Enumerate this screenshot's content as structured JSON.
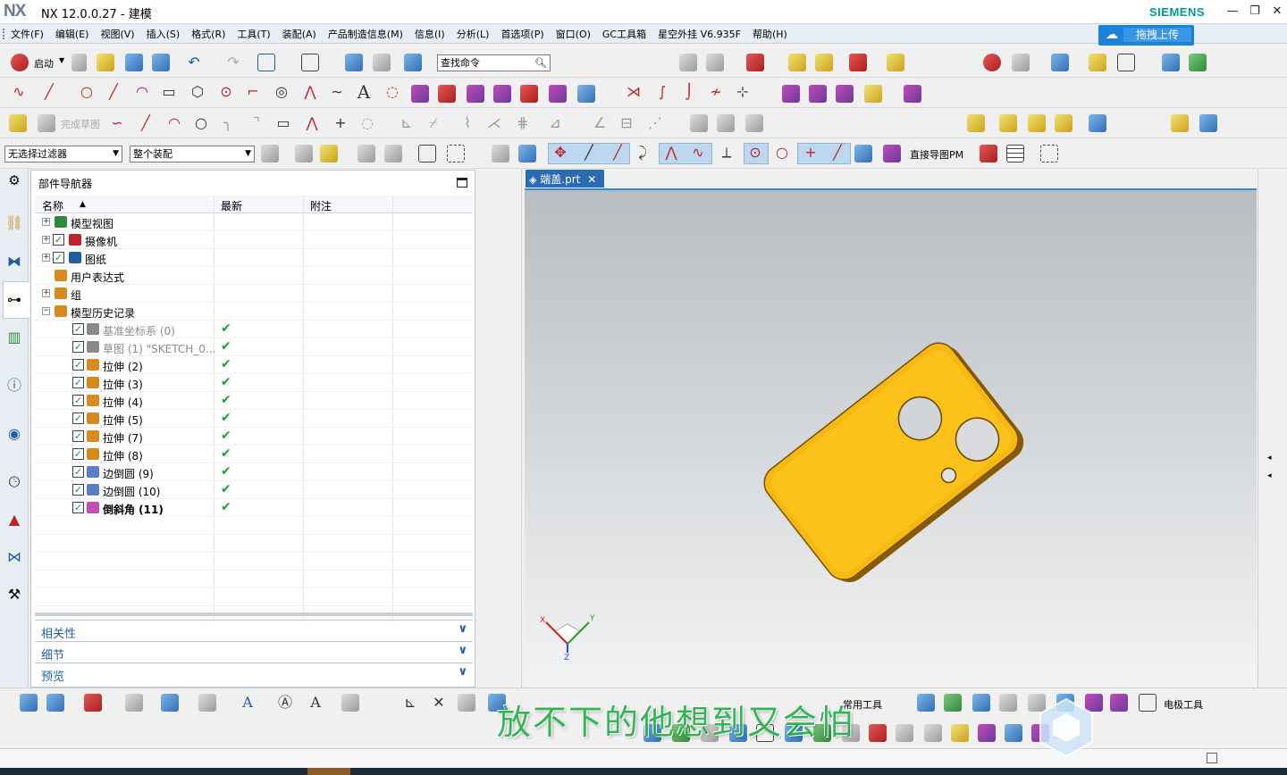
{
  "app": {
    "logo": "NX",
    "title": "NX 12.0.0.27 - 建模",
    "brand": "SIEMENS"
  },
  "window_controls": [
    "—",
    "❐",
    "✕"
  ],
  "menu": [
    "文件(F)",
    "编辑(E)",
    "视图(V)",
    "插入(S)",
    "格式(R)",
    "工具(T)",
    "装配(A)",
    "产品制造信息(M)",
    "信息(I)",
    "分析(L)",
    "首选项(P)",
    "窗口(O)",
    "GC工具箱",
    "星空外挂 V6.935F",
    "帮助(H)"
  ],
  "upload_button": "拖拽上传",
  "toolbar": {
    "start_label": "启动",
    "search_placeholder": "查找命令",
    "finish_sketch": "完成草图",
    "filter_select": "无选择过滤器",
    "assembly_select": "整个装配",
    "direct_sketch_pm": "直接导图PM"
  },
  "navigator": {
    "title": "部件导航器",
    "columns": [
      "名称",
      "最新",
      "附注"
    ],
    "rows": [
      {
        "label": "模型视图",
        "expand": "+",
        "checked": false,
        "status": "",
        "style": "normal"
      },
      {
        "label": "摄像机",
        "expand": "+",
        "checked": true,
        "status": "",
        "style": "normal"
      },
      {
        "label": "图纸",
        "expand": "+",
        "checked": true,
        "status": "",
        "style": "normal"
      },
      {
        "label": "用户表达式",
        "expand": "",
        "checked": false,
        "status": "",
        "style": "normal"
      },
      {
        "label": "组",
        "expand": "+",
        "checked": false,
        "status": "",
        "style": "normal"
      },
      {
        "label": "模型历史记录",
        "expand": "−",
        "checked": false,
        "status": "",
        "style": "normal"
      },
      {
        "label": "基准坐标系 (0)",
        "expand": "",
        "checked": true,
        "status": "✔",
        "style": "gray"
      },
      {
        "label": "草图 (1) \"SKETCH_0...",
        "expand": "",
        "checked": true,
        "status": "✔",
        "style": "gray"
      },
      {
        "label": "拉伸 (2)",
        "expand": "",
        "checked": true,
        "status": "✔",
        "style": "normal"
      },
      {
        "label": "拉伸 (3)",
        "expand": "",
        "checked": true,
        "status": "✔",
        "style": "normal"
      },
      {
        "label": "拉伸 (4)",
        "expand": "",
        "checked": true,
        "status": "✔",
        "style": "normal"
      },
      {
        "label": "拉伸 (5)",
        "expand": "",
        "checked": true,
        "status": "✔",
        "style": "normal"
      },
      {
        "label": "拉伸 (7)",
        "expand": "",
        "checked": true,
        "status": "✔",
        "style": "normal"
      },
      {
        "label": "拉伸 (8)",
        "expand": "",
        "checked": true,
        "status": "✔",
        "style": "normal"
      },
      {
        "label": "边倒圆 (9)",
        "expand": "",
        "checked": true,
        "status": "✔",
        "style": "normal"
      },
      {
        "label": "边倒圆 (10)",
        "expand": "",
        "checked": true,
        "status": "✔",
        "style": "normal"
      },
      {
        "label": "倒斜角 (11)",
        "expand": "",
        "checked": true,
        "status": "✔",
        "style": "bold"
      }
    ],
    "panels": [
      "相关性",
      "细节",
      "预览"
    ]
  },
  "document_tab": {
    "label": "端盖.prt",
    "close": "✕"
  },
  "triad": {
    "x": "X",
    "y": "Y",
    "z": "Z"
  },
  "bottom_toolbar": {
    "common_tools": "常用工具",
    "electrode_tools": "电极工具"
  },
  "watermark": "放不下的他想到又会怕",
  "colors": {
    "accent": "#2c6bb3",
    "part_face": "#fbbf14",
    "part_edge": "#8a5a00",
    "check": "#19a52b"
  }
}
